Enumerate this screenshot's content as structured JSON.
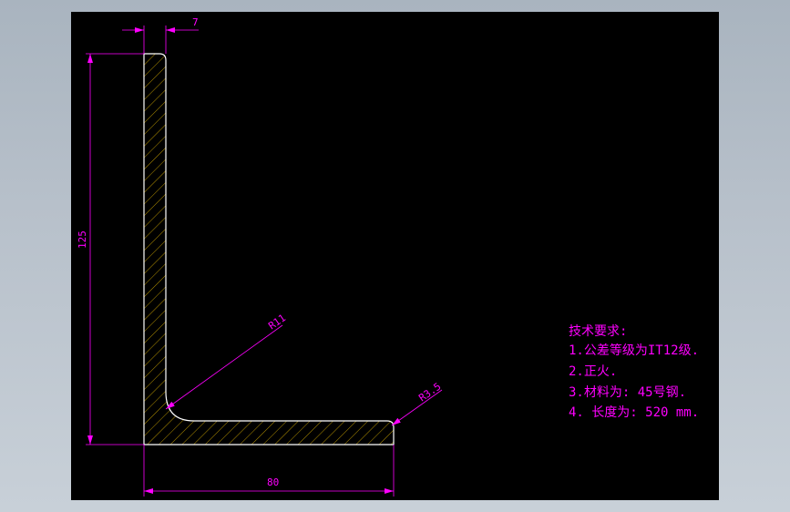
{
  "colors": {
    "background_outer": "#b3bcc6",
    "canvas": "#000000",
    "annotation": "#ff00ff",
    "outline": "#ffffff",
    "hatch": "#c8a000"
  },
  "dimensions": {
    "thickness": "7",
    "height": "125",
    "width": "80",
    "inner_radius": "R11",
    "toe_radius": "R3.5"
  },
  "notes": {
    "title": "技术要求:",
    "lines": [
      "1.公差等级为IT12级.",
      "2.正火.",
      "3.材料为: 45号钢.",
      "4. 长度为: 520 mm."
    ]
  }
}
